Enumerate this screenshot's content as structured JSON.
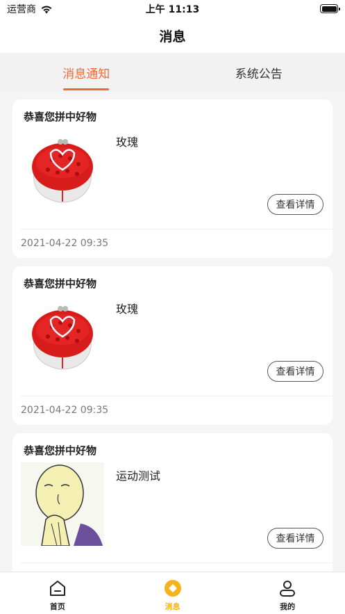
{
  "status_bar": {
    "carrier": "运营商",
    "time": "上午 11:13",
    "wifi_icon": "wifi-icon",
    "battery_icon": "battery-icon"
  },
  "nav": {
    "title": "消息"
  },
  "tabs": [
    {
      "label": "消息通知",
      "active": true
    },
    {
      "label": "系统公告",
      "active": false
    }
  ],
  "messages": [
    {
      "title": "恭喜您拼中好物",
      "product": "玫瑰",
      "image": "rose-bouquet",
      "button": "查看详情",
      "time": "2021-04-22 09:35"
    },
    {
      "title": "恭喜您拼中好物",
      "product": "玫瑰",
      "image": "rose-bouquet",
      "button": "查看详情",
      "time": "2021-04-22 09:35"
    },
    {
      "title": "恭喜您拼中好物",
      "product": "运动测试",
      "image": "cartoon-monk",
      "button": "查看详情",
      "time": ""
    }
  ],
  "tab_bar": [
    {
      "label": "首页",
      "icon": "home-icon",
      "active": false
    },
    {
      "label": "消息",
      "icon": "message-icon",
      "active": true
    },
    {
      "label": "我的",
      "icon": "user-icon",
      "active": false
    }
  ],
  "colors": {
    "accent": "#f06a35",
    "tab_bar_active": "#f6b21b",
    "background": "#f5f5f5"
  }
}
